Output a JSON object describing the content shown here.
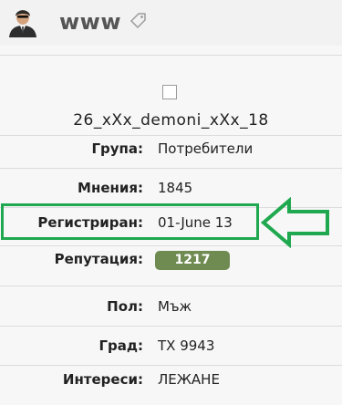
{
  "header": {
    "username": "www",
    "avatar_icon": "user-avatar-icon",
    "tag_icon": "tag-icon"
  },
  "profile": {
    "name": "26_xXx_demoni_xXx_18"
  },
  "fields": {
    "group": {
      "label": "Група:",
      "value": "Потребители"
    },
    "posts": {
      "label": "Мнения:",
      "value": "1845"
    },
    "registered": {
      "label": "Регистриран:",
      "value": "01-June 13"
    },
    "reputation": {
      "label": "Репутация:",
      "value": "1217"
    },
    "gender": {
      "label": "Пол:",
      "value": "Мъж"
    },
    "city": {
      "label": "Град:",
      "value": "TX 9943"
    },
    "interests": {
      "label": "Интереси:",
      "value": "ЛЕЖАНЕ"
    }
  },
  "colors": {
    "highlight": "#1fa84f",
    "reputation_badge": "#6f8b52"
  }
}
